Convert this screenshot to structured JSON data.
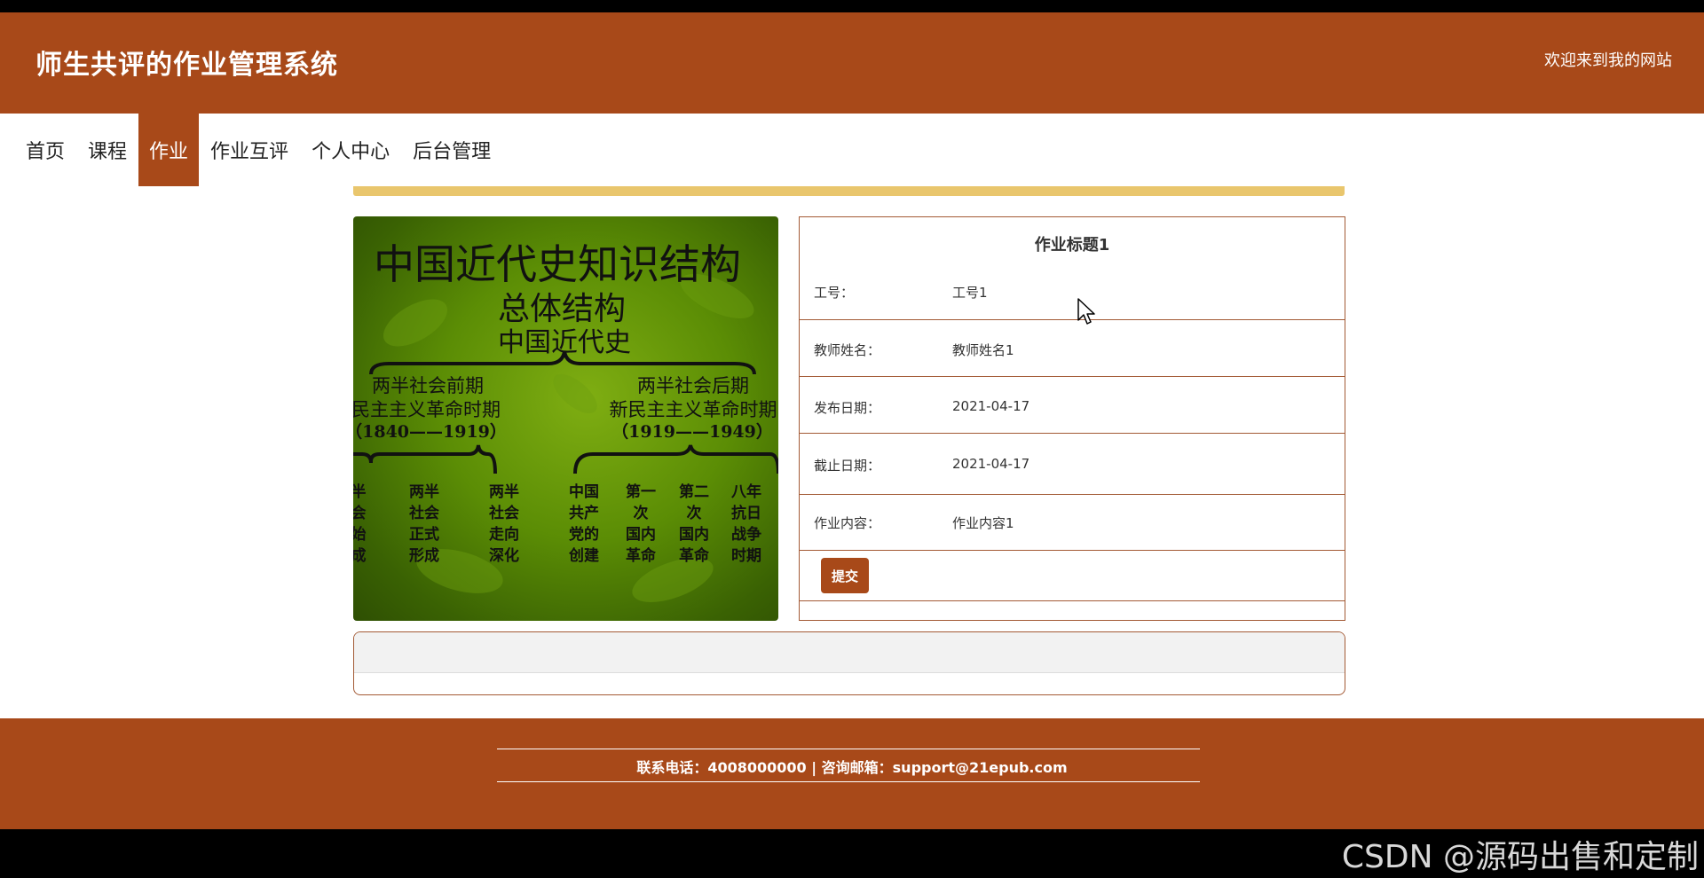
{
  "header": {
    "site_title": "师生共评的作业管理系统",
    "welcome": "欢迎来到我的网站"
  },
  "nav": {
    "items": [
      {
        "label": "首页"
      },
      {
        "label": "课程"
      },
      {
        "label": "作业",
        "active": true
      },
      {
        "label": "作业互评"
      },
      {
        "label": "个人中心"
      },
      {
        "label": "后台管理"
      }
    ]
  },
  "cover": {
    "lines": {
      "title": "中国近代史知识结构",
      "sub1": "总体结构",
      "sub2": "中国近代史",
      "left_period": "两半社会前期",
      "left_revolution": "民主主义革命时期",
      "left_years": "（1840——1919）",
      "right_period": "两半社会后期",
      "right_revolution": "新民主主义革命时期",
      "right_years": "（1919——1949）"
    },
    "columns": [
      [
        "半",
        "会",
        "始",
        "成"
      ],
      [
        "两半",
        "社会",
        "正式",
        "形成"
      ],
      [
        "两半",
        "社会",
        "走向",
        "深化"
      ],
      [
        "中国",
        "共产",
        "党的",
        "创建"
      ],
      [
        "第一",
        "次",
        "国内",
        "革命"
      ],
      [
        "第二",
        "次",
        "国内",
        "革命"
      ],
      [
        "八年",
        "抗日",
        "战争",
        "时期"
      ]
    ]
  },
  "details": {
    "title": "作业标题1",
    "fields": [
      {
        "label": "工号：",
        "value": "工号1"
      },
      {
        "label": "教师姓名：",
        "value": "教师姓名1"
      },
      {
        "label": "发布日期：",
        "value": "2021-04-17"
      },
      {
        "label": "截止日期：",
        "value": "2021-04-17"
      },
      {
        "label": "作业内容：",
        "value": "作业内容1"
      }
    ],
    "submit_label": "提交"
  },
  "footer": {
    "contact": "联系电话：4008000000 | 咨询邮箱：support@21epub.com"
  },
  "watermark": "CSDN @源码出售和定制",
  "colors": {
    "brand": "#a84919",
    "accent_bar": "#e9c66d",
    "border": "#a35a35"
  }
}
